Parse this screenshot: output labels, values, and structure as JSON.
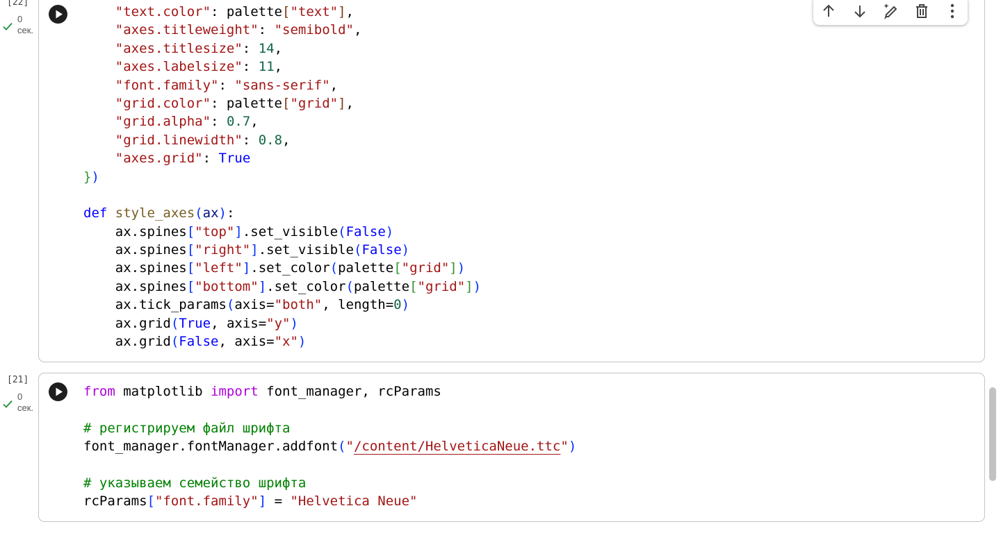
{
  "cells": [
    {
      "exec_count": "[22]",
      "duration_value": "0",
      "duration_unit": "сек.",
      "lines": [
        [
          [
            "t",
            "    "
          ],
          [
            "s",
            "\"text.color\""
          ],
          [
            "t",
            ": palette"
          ],
          [
            "b3",
            "["
          ],
          [
            "s",
            "\"text\""
          ],
          [
            "b3",
            "]"
          ],
          [
            "t",
            ","
          ]
        ],
        [
          [
            "t",
            "    "
          ],
          [
            "s",
            "\"axes.titleweight\""
          ],
          [
            "t",
            ": "
          ],
          [
            "s",
            "\"semibold\""
          ],
          [
            "t",
            ","
          ]
        ],
        [
          [
            "t",
            "    "
          ],
          [
            "s",
            "\"axes.titlesize\""
          ],
          [
            "t",
            ": "
          ],
          [
            "n",
            "14"
          ],
          [
            "t",
            ","
          ]
        ],
        [
          [
            "t",
            "    "
          ],
          [
            "s",
            "\"axes.labelsize\""
          ],
          [
            "t",
            ": "
          ],
          [
            "n",
            "11"
          ],
          [
            "t",
            ","
          ]
        ],
        [
          [
            "t",
            "    "
          ],
          [
            "s",
            "\"font.family\""
          ],
          [
            "t",
            ": "
          ],
          [
            "s",
            "\"sans-serif\""
          ],
          [
            "t",
            ","
          ]
        ],
        [
          [
            "t",
            "    "
          ],
          [
            "s",
            "\"grid.color\""
          ],
          [
            "t",
            ": palette"
          ],
          [
            "b3",
            "["
          ],
          [
            "s",
            "\"grid\""
          ],
          [
            "b3",
            "]"
          ],
          [
            "t",
            ","
          ]
        ],
        [
          [
            "t",
            "    "
          ],
          [
            "s",
            "\"grid.alpha\""
          ],
          [
            "t",
            ": "
          ],
          [
            "n",
            "0.7"
          ],
          [
            "t",
            ","
          ]
        ],
        [
          [
            "t",
            "    "
          ],
          [
            "s",
            "\"grid.linewidth\""
          ],
          [
            "t",
            ": "
          ],
          [
            "n",
            "0.8"
          ],
          [
            "t",
            ","
          ]
        ],
        [
          [
            "t",
            "    "
          ],
          [
            "s",
            "\"axes.grid\""
          ],
          [
            "t",
            ": "
          ],
          [
            "k",
            "True"
          ]
        ],
        [
          [
            "b2",
            "}"
          ],
          [
            "b1",
            ")"
          ]
        ],
        [],
        [
          [
            "k",
            "def"
          ],
          [
            "t",
            " "
          ],
          [
            "f",
            "style_axes"
          ],
          [
            "b1",
            "("
          ],
          [
            "v",
            "ax"
          ],
          [
            "b1",
            ")"
          ],
          [
            "t",
            ":"
          ]
        ],
        [
          [
            "t",
            "    ax.spines"
          ],
          [
            "b1",
            "["
          ],
          [
            "s",
            "\"top\""
          ],
          [
            "b1",
            "]"
          ],
          [
            "t",
            ".set_visible"
          ],
          [
            "b1",
            "("
          ],
          [
            "k",
            "False"
          ],
          [
            "b1",
            ")"
          ]
        ],
        [
          [
            "t",
            "    ax.spines"
          ],
          [
            "b1",
            "["
          ],
          [
            "s",
            "\"right\""
          ],
          [
            "b1",
            "]"
          ],
          [
            "t",
            ".set_visible"
          ],
          [
            "b1",
            "("
          ],
          [
            "k",
            "False"
          ],
          [
            "b1",
            ")"
          ]
        ],
        [
          [
            "t",
            "    ax.spines"
          ],
          [
            "b1",
            "["
          ],
          [
            "s",
            "\"left\""
          ],
          [
            "b1",
            "]"
          ],
          [
            "t",
            ".set_color"
          ],
          [
            "b1",
            "("
          ],
          [
            "t",
            "palette"
          ],
          [
            "b2",
            "["
          ],
          [
            "s",
            "\"grid\""
          ],
          [
            "b2",
            "]"
          ],
          [
            "b1",
            ")"
          ]
        ],
        [
          [
            "t",
            "    ax.spines"
          ],
          [
            "b1",
            "["
          ],
          [
            "s",
            "\"bottom\""
          ],
          [
            "b1",
            "]"
          ],
          [
            "t",
            ".set_color"
          ],
          [
            "b1",
            "("
          ],
          [
            "t",
            "palette"
          ],
          [
            "b2",
            "["
          ],
          [
            "s",
            "\"grid\""
          ],
          [
            "b2",
            "]"
          ],
          [
            "b1",
            ")"
          ]
        ],
        [
          [
            "t",
            "    ax.tick_params"
          ],
          [
            "b1",
            "("
          ],
          [
            "t",
            "axis="
          ],
          [
            "s",
            "\"both\""
          ],
          [
            "t",
            ", length="
          ],
          [
            "n",
            "0"
          ],
          [
            "b1",
            ")"
          ]
        ],
        [
          [
            "t",
            "    ax.grid"
          ],
          [
            "b1",
            "("
          ],
          [
            "k",
            "True"
          ],
          [
            "t",
            ", axis="
          ],
          [
            "s",
            "\"y\""
          ],
          [
            "b1",
            ")"
          ]
        ],
        [
          [
            "t",
            "    ax.grid"
          ],
          [
            "b1",
            "("
          ],
          [
            "k",
            "False"
          ],
          [
            "t",
            ", axis="
          ],
          [
            "s",
            "\"x\""
          ],
          [
            "b1",
            ")"
          ]
        ]
      ]
    },
    {
      "exec_count": "[21]",
      "duration_value": "0",
      "duration_unit": "сек.",
      "lines": [
        [
          [
            "p",
            "from"
          ],
          [
            "t",
            " matplotlib "
          ],
          [
            "p",
            "import"
          ],
          [
            "t",
            " font_manager, rcParams"
          ]
        ],
        [],
        [
          [
            "c",
            "# регистрируем файл шрифта"
          ]
        ],
        [
          [
            "t",
            "font_manager.fontManager.addfont"
          ],
          [
            "b1",
            "("
          ],
          [
            "s",
            "\""
          ],
          [
            "su",
            "/content/HelveticaNeue.ttc"
          ],
          [
            "s",
            "\""
          ],
          [
            "b1",
            ")"
          ]
        ],
        [],
        [
          [
            "c",
            "# указываем семейство шрифта"
          ]
        ],
        [
          [
            "t",
            "rcParams"
          ],
          [
            "b1",
            "["
          ],
          [
            "s",
            "\"font.family\""
          ],
          [
            "b1",
            "]"
          ],
          [
            "t",
            " = "
          ],
          [
            "s",
            "\"Helvetica Neue\""
          ]
        ]
      ]
    }
  ],
  "toolbar": [
    "move-cell-up",
    "move-cell-down",
    "edit-with-ai",
    "delete-cell",
    "more-actions"
  ],
  "colors": {
    "string": "#a31515",
    "number": "#116644",
    "keyword": "#0000ff",
    "import": "#af00db",
    "comment": "#008000"
  }
}
